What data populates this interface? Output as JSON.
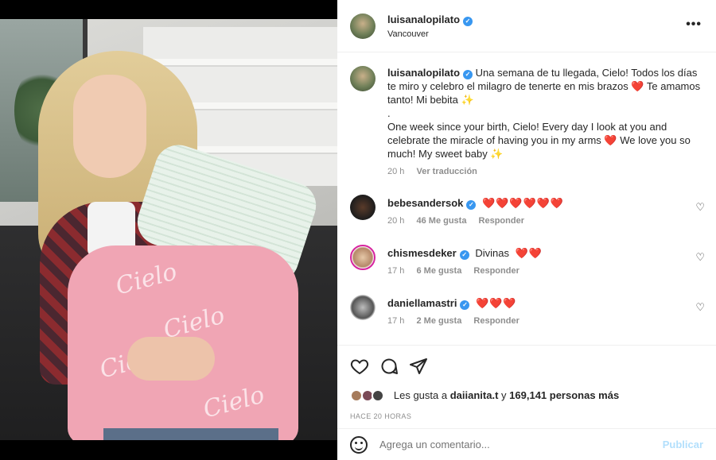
{
  "post": {
    "owner": "luisanalopilato",
    "location": "Vancouver",
    "caption_es": "Una semana de tu llegada, Cielo! Todos los días te miro y celebro el milagro de tenerte en mis brazos ❤️ Te amamos tanto! Mi bebita ✨",
    "caption_dot": ".",
    "caption_en": "One week since your birth, Cielo! Every day I look at you and celebrate the miracle of having you in my arms ❤️ We love you so much! My sweet baby ✨",
    "caption_time": "20 h",
    "translate": "Ver traducción",
    "blanket_text": "Cielo"
  },
  "comments": [
    {
      "user": "bebesandersok",
      "text": "❤️❤️❤️❤️❤️❤️",
      "time": "20 h",
      "likes": "46 Me gusta",
      "reply": "Responder"
    },
    {
      "user": "chismesdeker",
      "text": "Divinas",
      "hearts": "❤️❤️",
      "time": "17 h",
      "likes": "6 Me gusta",
      "reply": "Responder"
    },
    {
      "user": "daniellamastri",
      "text": "❤️❤️❤️",
      "time": "17 h",
      "likes": "2 Me gusta",
      "reply": "Responder"
    }
  ],
  "likes": {
    "prefix": "Les gusta a",
    "user": "daiianita.t",
    "joiner": "y",
    "count": "169,141 personas más"
  },
  "timestamp": "HACE 20 HORAS",
  "comment_box": {
    "placeholder": "Agrega un comentario...",
    "publish": "Publicar"
  },
  "icons": {
    "heart": "heart-icon",
    "comment": "comment-icon",
    "share": "share-icon",
    "more": "more-options-icon",
    "emoji": "emoji-icon"
  },
  "colors": {
    "verified": "#3897f0",
    "heart": "#e0245e",
    "publish": "#b2dffc"
  }
}
